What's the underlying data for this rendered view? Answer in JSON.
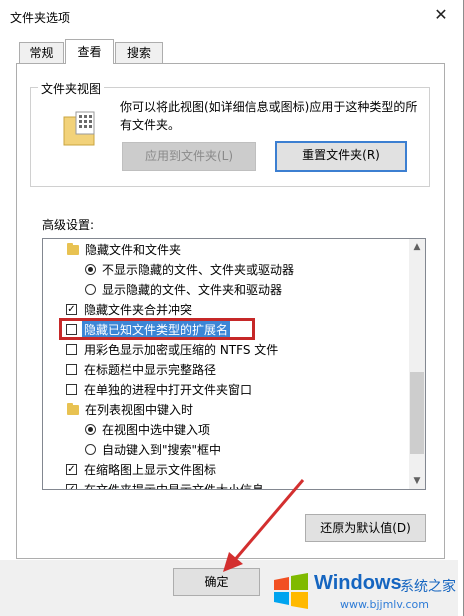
{
  "dialog": {
    "title": "文件夹选项",
    "close_glyph": "✕"
  },
  "tabs": [
    {
      "label": "常规",
      "active": false
    },
    {
      "label": "查看",
      "active": true
    },
    {
      "label": "搜索",
      "active": false
    }
  ],
  "folder_views": {
    "group_title": "文件夹视图",
    "description": "你可以将此视图(如详细信息或图标)应用于这种类型的所有文件夹。",
    "apply_button": "应用到文件夹(L)",
    "reset_button": "重置文件夹(R)"
  },
  "advanced": {
    "label": "高级设置:",
    "items": [
      {
        "type": "folder",
        "label": "隐藏文件和文件夹"
      },
      {
        "type": "radio",
        "checked": true,
        "label": "不显示隐藏的文件、文件夹或驱动器"
      },
      {
        "type": "radio",
        "checked": false,
        "label": "显示隐藏的文件、文件夹和驱动器"
      },
      {
        "type": "checkbox",
        "checked": true,
        "label": "隐藏文件夹合并冲突"
      },
      {
        "type": "checkbox",
        "checked": false,
        "label": "隐藏已知文件类型的扩展名",
        "highlighted": true
      },
      {
        "type": "checkbox",
        "checked": false,
        "label": "用彩色显示加密或压缩的 NTFS 文件"
      },
      {
        "type": "checkbox",
        "checked": false,
        "label": "在标题栏中显示完整路径"
      },
      {
        "type": "checkbox",
        "checked": false,
        "label": "在单独的进程中打开文件夹窗口"
      },
      {
        "type": "folder",
        "label": "在列表视图中键入时"
      },
      {
        "type": "radio",
        "checked": true,
        "label": "在视图中选中键入项"
      },
      {
        "type": "radio",
        "checked": false,
        "label": "自动键入到\"搜索\"框中"
      },
      {
        "type": "checkbox",
        "checked": true,
        "label": "在缩略图上显示文件图标"
      },
      {
        "type": "checkbox",
        "checked": true,
        "label": "在文件夹提示中显示文件大小信息"
      }
    ],
    "restore_defaults_button": "还原为默认值(D)"
  },
  "footer": {
    "ok_button": "确定"
  },
  "watermark": {
    "brand": "Windows",
    "brand_cn": "系统之家",
    "url": "www.bjjmlv.com"
  },
  "colors": {
    "annotation_red": "#c62828",
    "selection_blue": "#3c86d6",
    "focus_blue": "#3c7fd1"
  }
}
